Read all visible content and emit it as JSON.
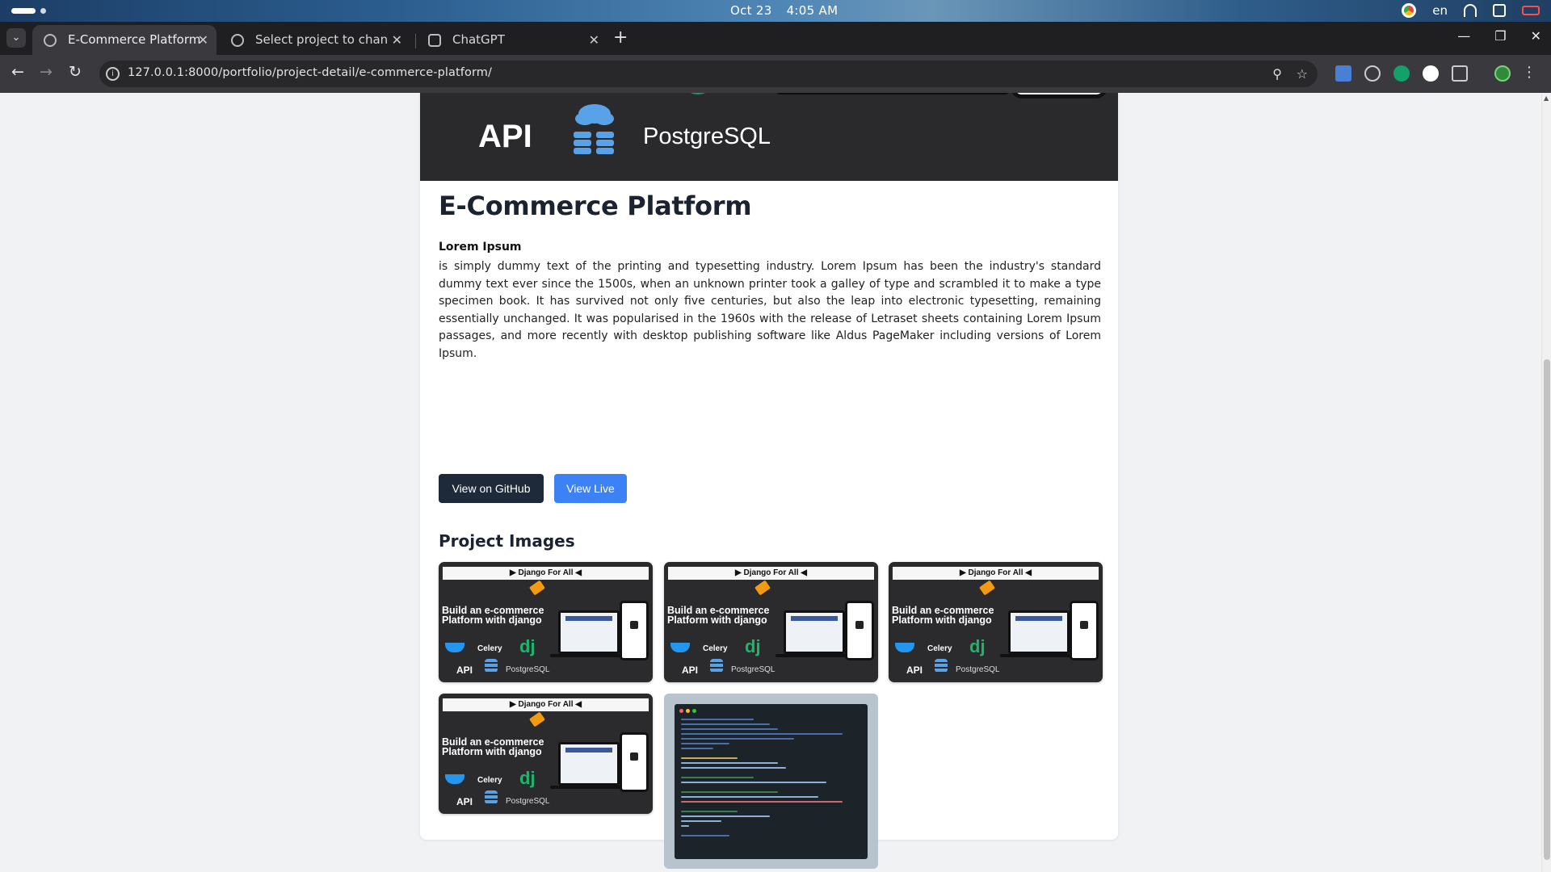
{
  "os": {
    "date": "Oct 23",
    "time": "4:05 AM",
    "lang": "en"
  },
  "browser": {
    "tabs": [
      {
        "label": "E-Commerce Platform | F",
        "active": true
      },
      {
        "label": "Select project to change",
        "active": false
      },
      {
        "label": "ChatGPT",
        "active": false
      }
    ],
    "url": "127.0.0.1:8000/portfolio/project-detail/e-commerce-platform/"
  },
  "hero": {
    "api_text": "API",
    "db_text": "PostgreSQL"
  },
  "project": {
    "title": "E-Commerce Platform",
    "desc_heading": "Lorem Ipsum",
    "desc_body": " is simply dummy text of the printing and typesetting industry. Lorem Ipsum has been the industry's standard dummy text ever since the 1500s, when an unknown printer took a galley of type and scrambled it to make a type specimen book. It has survived not only five centuries, but also the leap into electronic typesetting, remaining essentially unchanged. It was popularised in the 1960s with the release of Letraset sheets containing Lorem Ipsum passages, and more recently with desktop publishing software like Aldus PageMaker including versions of Lorem Ipsum.",
    "github_label": "View on GitHub",
    "live_label": "View Live",
    "images_heading": "Project Images"
  },
  "thumbnail": {
    "banner": "▶ Django For All ◀",
    "headline": "Build an e-commerce Platform with django",
    "celery": "Celery",
    "dj": "dj",
    "api": "API",
    "postgres": "PostgreSQL"
  },
  "colors": {
    "github_button": "#1e2939",
    "live_button": "#3d82f5",
    "title": "#1b2230"
  }
}
